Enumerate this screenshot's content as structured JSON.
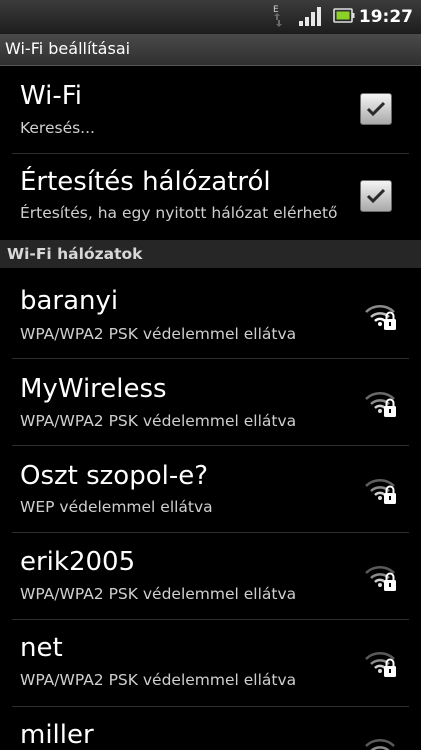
{
  "status_bar": {
    "time": "19:27",
    "data_indicator": "E",
    "icons": [
      "data-transfer-icon",
      "signal-icon",
      "battery-icon"
    ]
  },
  "title_bar": {
    "title": "Wi-Fi beállításai"
  },
  "settings": [
    {
      "title": "Wi-Fi",
      "subtitle": "Keresés...",
      "checked": true
    },
    {
      "title": "Értesítés hálózatról",
      "subtitle": "Értesítés, ha egy nyitott hálózat elérhető",
      "checked": true
    }
  ],
  "networks_header": "Wi-Fi hálózatok",
  "networks": [
    {
      "ssid": "baranyi",
      "security": "WPA/WPA2 PSK védelemmel ellátva",
      "icon": "wifi-lock-icon"
    },
    {
      "ssid": "MyWireless",
      "security": "WPA/WPA2 PSK védelemmel ellátva",
      "icon": "wifi-lock-icon"
    },
    {
      "ssid": "Oszt szopol-e?",
      "security": "WEP védelemmel ellátva",
      "icon": "wifi-lock-icon"
    },
    {
      "ssid": "erik2005",
      "security": "WPA/WPA2 PSK védelemmel ellátva",
      "icon": "wifi-lock-icon"
    },
    {
      "ssid": "net",
      "security": "WPA/WPA2 PSK védelemmel ellátva",
      "icon": "wifi-lock-icon"
    },
    {
      "ssid": "miller",
      "security": "",
      "icon": "wifi-lock-icon"
    }
  ],
  "colors": {
    "background": "#000000",
    "primary_text": "#ffffff",
    "secondary_text": "#cfcfcf",
    "section_header_bg": "#262626"
  }
}
